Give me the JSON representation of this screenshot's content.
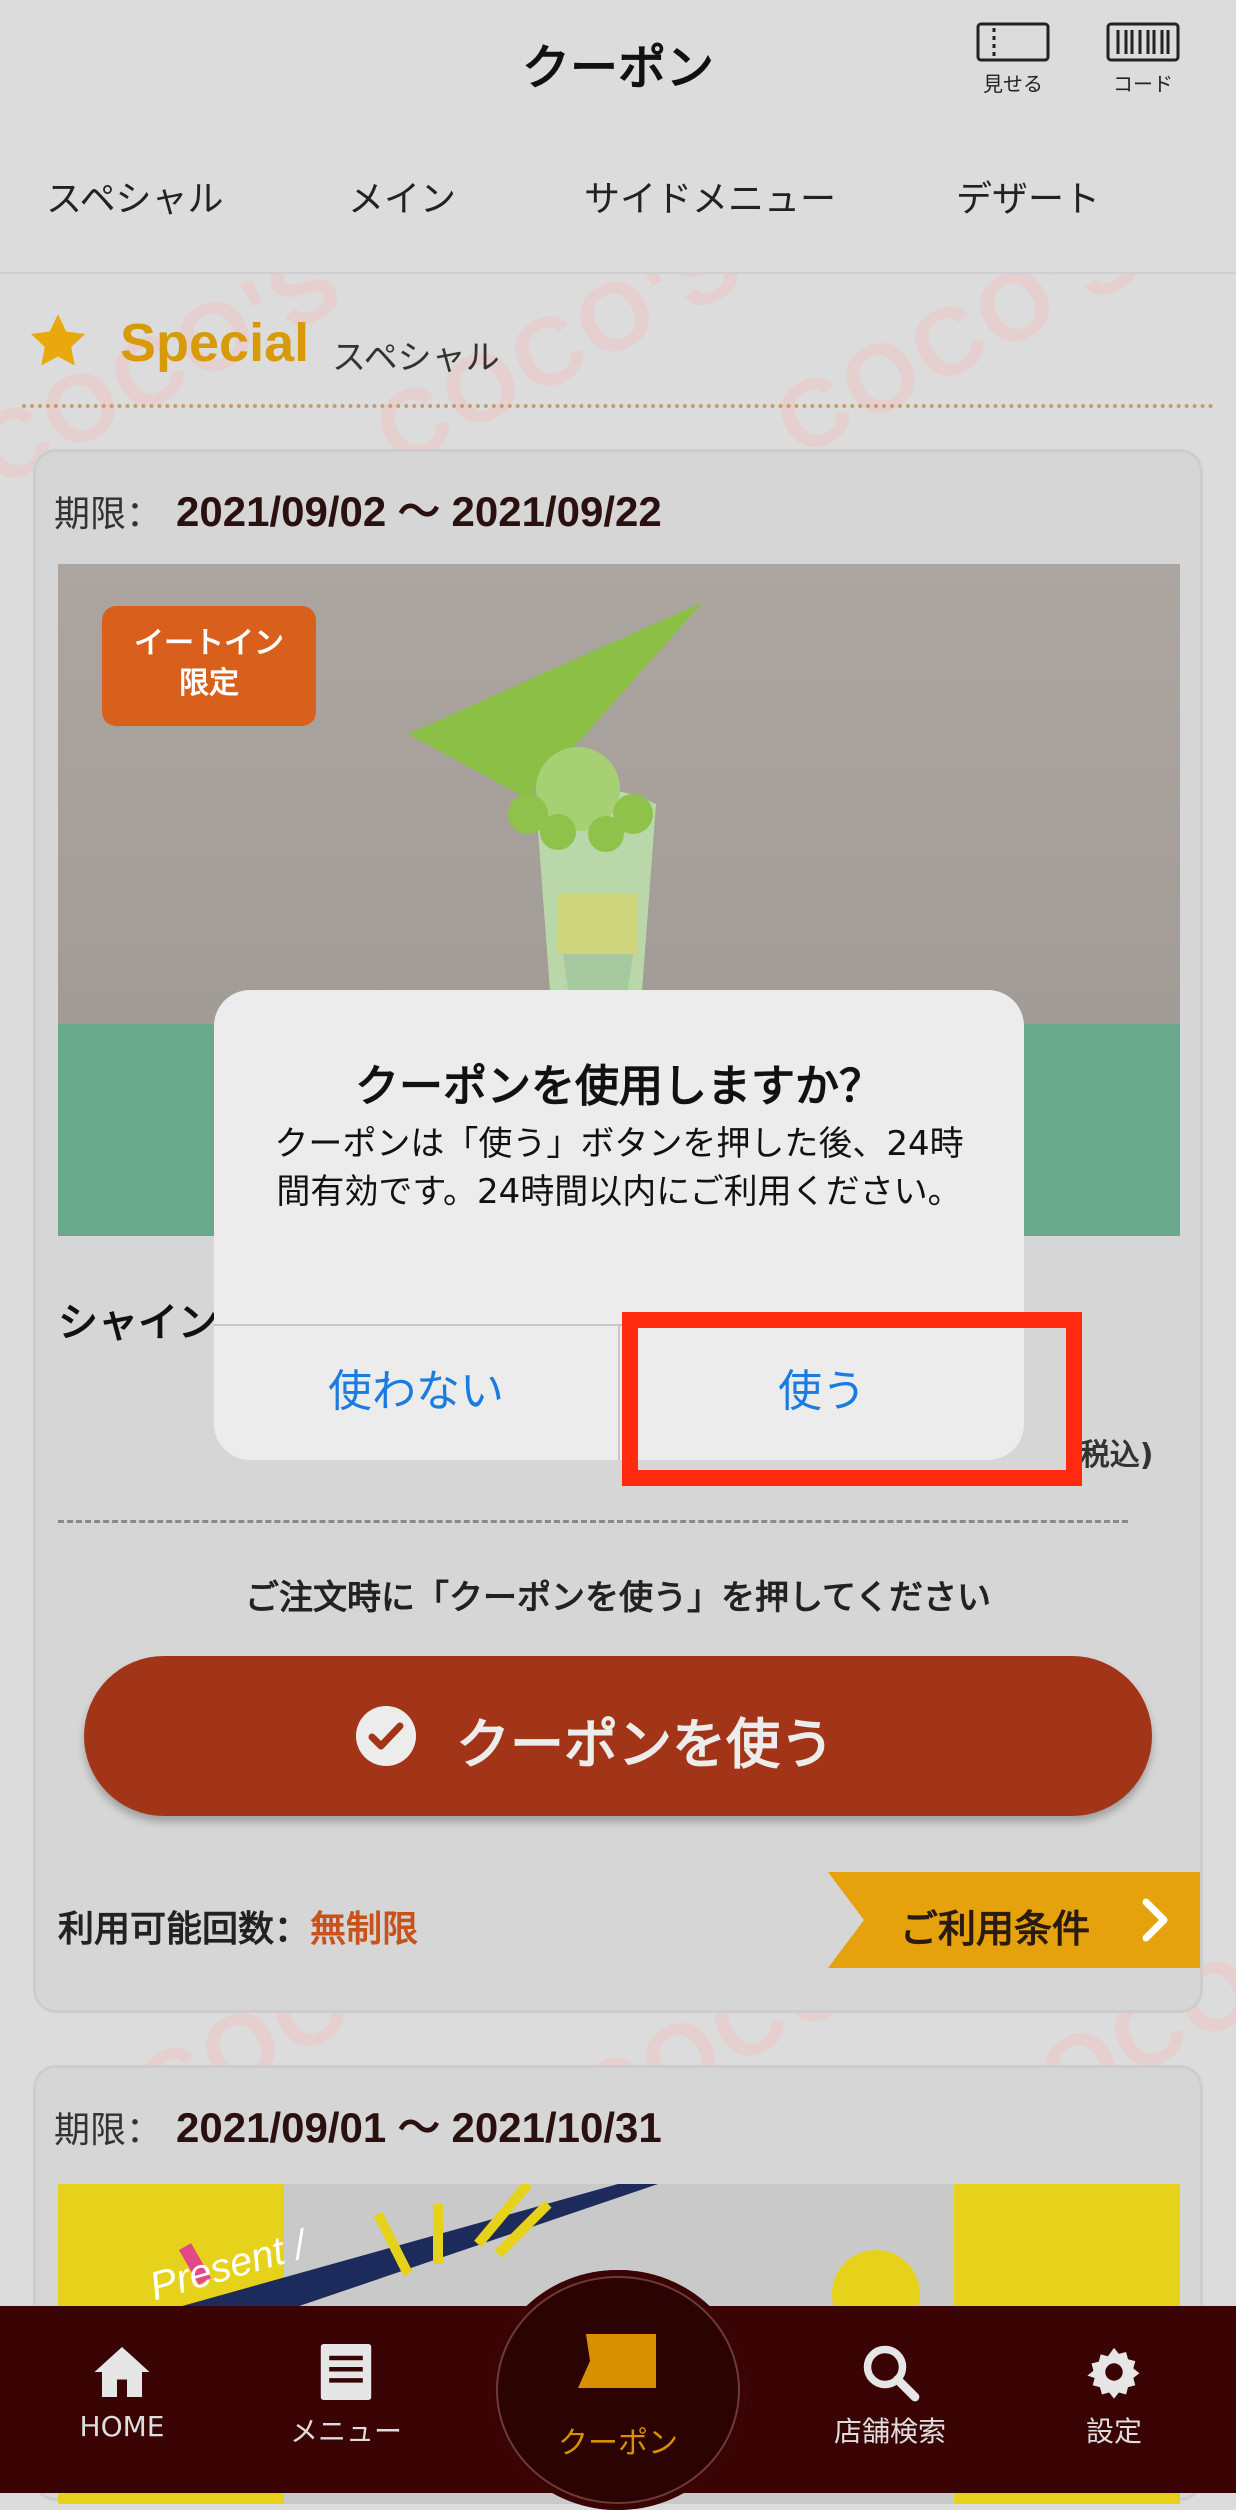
{
  "header": {
    "title": "クーポン",
    "show_label": "見せる",
    "code_label": "コード",
    "tabs": [
      "スペシャル",
      "メイン",
      "サイドメニュー",
      "デザート"
    ]
  },
  "section": {
    "title": "Special",
    "subtitle": "スペシャル"
  },
  "watermark_text": "COCO'S",
  "coupon1": {
    "period_label": "期限：",
    "period_value": "2021/09/02 ～ 2021/09/22",
    "badge_line1": "イートイン",
    "badge_line2": "限定",
    "name_partial": "シャイン",
    "tax_note": "(税込)",
    "instruction": "ご注文時に「クーポンを使う」を押してください",
    "use_button": "クーポンを使う",
    "count_label": "利用可能回数：",
    "count_value": "無制限",
    "conditions_button": "ご利用条件"
  },
  "coupon2": {
    "period_label": "期限：",
    "period_value": "2021/09/01 ～ 2021/10/31",
    "banner_text": "Present /"
  },
  "dialog": {
    "title": "クーポンを使用しますか？",
    "message": "クーポンは「使う」ボタンを押した後、24時間有効です。24時間以内にご利用ください。",
    "cancel": "使わない",
    "confirm": "使う"
  },
  "bottom_nav": {
    "home": "HOME",
    "menu": "メニュー",
    "coupon": "クーポン",
    "store": "店舗検索",
    "settings": "設定"
  },
  "colors": {
    "accent_gold": "#d89a0a",
    "use_button": "#a23418",
    "dialog_link": "#1a7ce0",
    "highlight": "#ff2a10",
    "nav_bg": "#3a0404"
  }
}
